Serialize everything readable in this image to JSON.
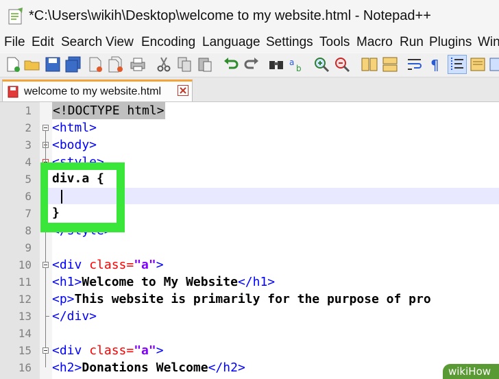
{
  "window": {
    "title": "*C:\\Users\\wikih\\Desktop\\welcome to my website.html - Notepad++"
  },
  "menu": [
    "File",
    "Edit",
    "Search",
    "View",
    "Encoding",
    "Language",
    "Settings",
    "Tools",
    "Macro",
    "Run",
    "Plugins",
    "Win"
  ],
  "toolbar": [
    "new-file",
    "open-file",
    "save",
    "save-all",
    "close",
    "close-all",
    "print",
    "cut",
    "copy",
    "paste",
    "undo",
    "redo",
    "find",
    "replace",
    "zoom-in",
    "zoom-out",
    "sync-vertical",
    "sync-horizontal",
    "word-wrap",
    "show-all-chars",
    "indent-guide",
    "doc-map"
  ],
  "tab": {
    "label": "welcome to my website.html"
  },
  "editor": {
    "lines": [
      {
        "n": "1",
        "code": "<!DOCTYPE html>"
      },
      {
        "n": "2",
        "code": "<html>"
      },
      {
        "n": "3",
        "code": "<body>"
      },
      {
        "n": "4",
        "code": "<style>"
      },
      {
        "n": "5",
        "code": "div.a {"
      },
      {
        "n": "6",
        "code": ""
      },
      {
        "n": "7",
        "code": "}"
      },
      {
        "n": "8",
        "code": "</style>"
      },
      {
        "n": "9",
        "code": ""
      },
      {
        "n": "10",
        "code": "<div class=\"a\">"
      },
      {
        "n": "11",
        "code": "<h1>Welcome to My Website</h1>"
      },
      {
        "n": "12",
        "code": "<p>This website is primarily for the purpose of pro"
      },
      {
        "n": "13",
        "code": "</div>"
      },
      {
        "n": "14",
        "code": ""
      },
      {
        "n": "15",
        "code": "<div class=\"a\">"
      },
      {
        "n": "16",
        "code": "<h2>Donations Welcome</h2>"
      }
    ]
  },
  "watermark": {
    "text": "wikiHow"
  },
  "colors": {
    "tag": "#0000ff",
    "attr": "#ff0000",
    "value": "#8000ff",
    "highlight": "#39e639",
    "current_line": "#e8e8ff"
  }
}
